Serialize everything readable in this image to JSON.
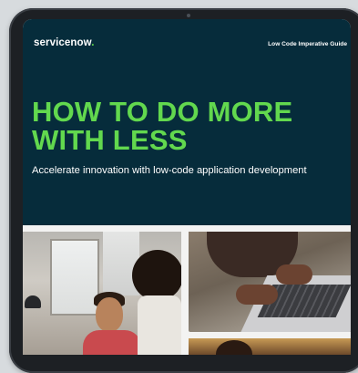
{
  "brand": {
    "logo_text": "servicenow",
    "logo_dot": ".",
    "accent_color": "#62d84e",
    "hero_bg": "#062c3b"
  },
  "header": {
    "guide_label": "Low Code Imperative Guide"
  },
  "hero": {
    "headline_line1": "HOW TO DO MORE",
    "headline_line2": "WITH LESS",
    "subtitle": "Accelerate innovation with low-code application development"
  },
  "photos": {
    "left": "office-meeting-photo",
    "right_top": "laptop-typing-photo",
    "right_bottom": "person-photo"
  }
}
